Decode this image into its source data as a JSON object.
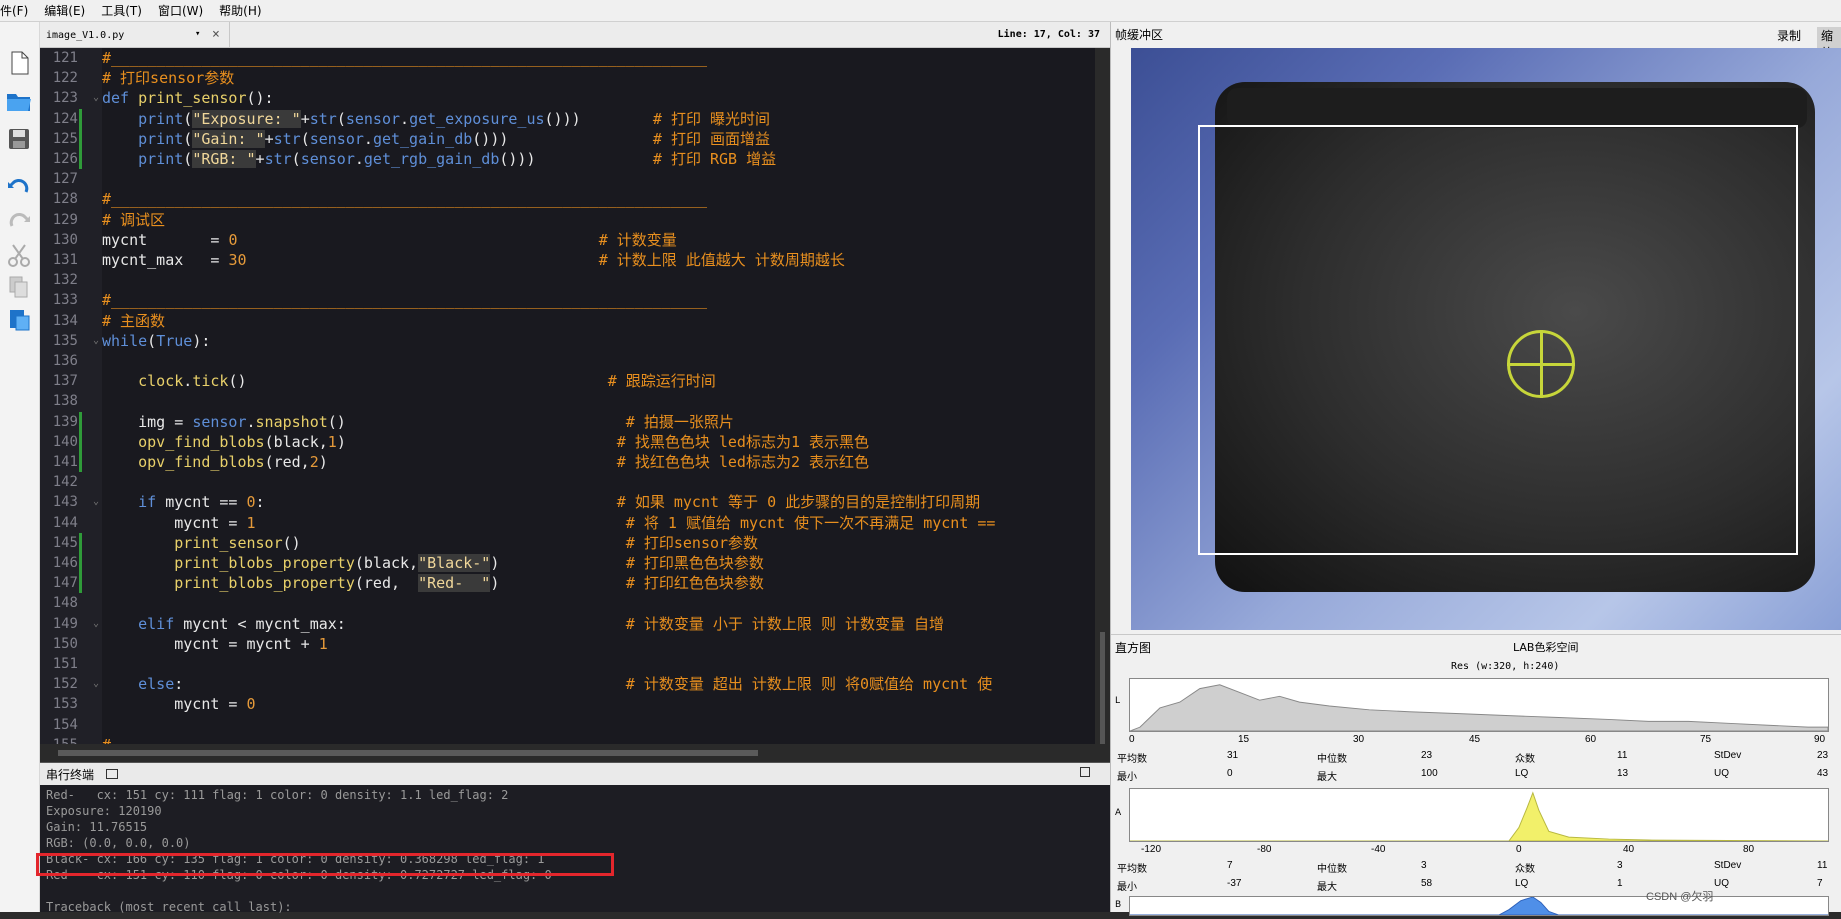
{
  "menu": [
    "件(F)",
    "编辑(E)",
    "工具(T)",
    "窗口(W)",
    "帮助(H)"
  ],
  "editor": {
    "tab_name": "image_V1.0.py",
    "dropdown_glyph": "▾",
    "close_glyph": "×",
    "line_col": "Line: 17, Col: 37",
    "lines": [
      {
        "n": "121",
        "fold": "",
        "bar": false,
        "h": "<span class=\"cm\">#__________________________________________________________________</span>"
      },
      {
        "n": "122",
        "fold": "",
        "bar": false,
        "h": "<span class=\"cm\"># 打印sensor参数</span>"
      },
      {
        "n": "123",
        "fold": "⌄",
        "bar": false,
        "h": "<span class=\"kw\">def</span> <span class=\"fn\">print_sensor</span>():"
      },
      {
        "n": "124",
        "fold": "",
        "bar": true,
        "h": "    <span class=\"bi\">print</span>(<span class=\"sth\">\"Exposure: \"</span>+<span class=\"bi\">str</span>(<span class=\"sn\">sensor</span>.<span class=\"bi\">get_exposure_us</span>()))        <span class=\"cm\"># 打印 曝光时间</span>"
      },
      {
        "n": "125",
        "fold": "",
        "bar": true,
        "h": "    <span class=\"bi\">print</span>(<span class=\"sth\">\"Gain: \"</span>+<span class=\"bi\">str</span>(<span class=\"sn\">sensor</span>.<span class=\"bi\">get_gain_db</span>()))                <span class=\"cm\"># 打印 画面增益</span>"
      },
      {
        "n": "126",
        "fold": "",
        "bar": true,
        "h": "    <span class=\"bi\">print</span>(<span class=\"sth\">\"RGB: \"</span>+<span class=\"bi\">str</span>(<span class=\"sn\">sensor</span>.<span class=\"bi\">get_rgb_gain_db</span>()))             <span class=\"cm\"># 打印 RGB 增益</span>"
      },
      {
        "n": "127",
        "fold": "",
        "bar": false,
        "h": ""
      },
      {
        "n": "128",
        "fold": "",
        "bar": false,
        "h": "<span class=\"cm\">#__________________________________________________________________</span>"
      },
      {
        "n": "129",
        "fold": "",
        "bar": false,
        "h": "<span class=\"cm\"># 调试区</span>"
      },
      {
        "n": "130",
        "fold": "",
        "bar": false,
        "h": "mycnt       = <span class=\"nm\">0</span>                                        <span class=\"cm\"># 计数变量</span>"
      },
      {
        "n": "131",
        "fold": "",
        "bar": false,
        "h": "mycnt_max   = <span class=\"nm\">30</span>                                       <span class=\"cm\"># 计数上限 此值越大 计数周期越长</span>"
      },
      {
        "n": "132",
        "fold": "",
        "bar": false,
        "h": ""
      },
      {
        "n": "133",
        "fold": "",
        "bar": false,
        "h": "<span class=\"cm\">#__________________________________________________________________</span>"
      },
      {
        "n": "134",
        "fold": "",
        "bar": false,
        "h": "<span class=\"cm\"># 主函数</span>"
      },
      {
        "n": "135",
        "fold": "⌄",
        "bar": false,
        "h": "<span class=\"kw\">while</span>(<span class=\"kw\">True</span>):"
      },
      {
        "n": "136",
        "fold": "",
        "bar": false,
        "h": ""
      },
      {
        "n": "137",
        "fold": "",
        "bar": false,
        "h": "    <span class=\"fc\">clock</span>.<span class=\"fc\">tick</span>()                                        <span class=\"cm\"># 跟踪运行时间</span>"
      },
      {
        "n": "138",
        "fold": "",
        "bar": false,
        "h": ""
      },
      {
        "n": "139",
        "fold": "",
        "bar": true,
        "h": "    img = <span class=\"sn\">sensor</span>.<span class=\"fc\">snapshot</span>()                               <span class=\"cm\"># 拍摄一张照片</span>"
      },
      {
        "n": "140",
        "fold": "",
        "bar": true,
        "h": "    <span class=\"fc\">opv_find_blobs</span>(black,<span class=\"nm\">1</span>)                              <span class=\"cm\"># 找黑色色块 led标志为1 表示黑色</span>"
      },
      {
        "n": "141",
        "fold": "",
        "bar": true,
        "h": "    <span class=\"fc\">opv_find_blobs</span>(red,<span class=\"nm\">2</span>)                                <span class=\"cm\"># 找红色色块 led标志为2 表示红色</span>"
      },
      {
        "n": "142",
        "fold": "",
        "bar": false,
        "h": ""
      },
      {
        "n": "143",
        "fold": "⌄",
        "bar": false,
        "h": "    <span class=\"kw\">if</span> mycnt == <span class=\"nm\">0</span>:                                       <span class=\"cm\"># 如果 mycnt 等于 0 此步骤的目的是控制打印周期</span>"
      },
      {
        "n": "144",
        "fold": "",
        "bar": false,
        "h": "        mycnt = <span class=\"nm\">1</span>                                         <span class=\"cm\"># 将 1 赋值给 mycnt 使下一次不再满足 mycnt ==</span>"
      },
      {
        "n": "145",
        "fold": "",
        "bar": true,
        "h": "        <span class=\"fc\">print_sensor</span>()                                    <span class=\"cm\"># 打印sensor参数</span>"
      },
      {
        "n": "146",
        "fold": "",
        "bar": true,
        "h": "        <span class=\"fc\">print_blobs_property</span>(black,<span class=\"sth\">\"Black-\"</span>)              <span class=\"cm\"># 打印黑色色块参数</span>"
      },
      {
        "n": "147",
        "fold": "",
        "bar": true,
        "h": "        <span class=\"fc\">print_blobs_property</span>(red,  <span class=\"sth\">\"Red-  \"</span>)              <span class=\"cm\"># 打印红色色块参数</span>"
      },
      {
        "n": "148",
        "fold": "",
        "bar": false,
        "h": ""
      },
      {
        "n": "149",
        "fold": "⌄",
        "bar": false,
        "h": "    <span class=\"kw\">elif</span> mycnt &lt; mycnt_max:                               <span class=\"cm\"># 计数变量 小于 计数上限 则 计数变量 自增</span>"
      },
      {
        "n": "150",
        "fold": "",
        "bar": false,
        "h": "        mycnt = mycnt + <span class=\"nm\">1</span>"
      },
      {
        "n": "151",
        "fold": "",
        "bar": false,
        "h": ""
      },
      {
        "n": "152",
        "fold": "⌄",
        "bar": false,
        "h": "    <span class=\"kw\">else</span>:                                                 <span class=\"cm\"># 计数变量 超出 计数上限 则 将0赋值给 mycnt 使</span>"
      },
      {
        "n": "153",
        "fold": "",
        "bar": false,
        "h": "        mycnt = <span class=\"nm\">0</span>"
      },
      {
        "n": "154",
        "fold": "",
        "bar": false,
        "h": ""
      },
      {
        "n": "155",
        "fold": "",
        "bar": false,
        "h": "<span class=\"cm\">#__________________________________________________________________</span>"
      }
    ]
  },
  "serial": {
    "title": "串行终端",
    "lines": [
      "Red-   cx: 151 cy: 111 flag: 1 color: 0 density: 1.1 led_flag: 2",
      "Exposure: 120190",
      "Gain: 11.76515",
      "RGB: (0.0, 0.0, 0.0)",
      "Black- cx: 166 cy: 135 flag: 1 color: 0 density: 0.368298 led_flag: 1",
      "Red-   cx: 151 cy: 110 flag: 0 color: 0 density: 0.7272727 led_flag: 0",
      "",
      "Traceback (most recent call last):"
    ]
  },
  "framebuffer": {
    "title": "帧缓冲区",
    "record": "录制",
    "zoom": "缩放"
  },
  "histogram": {
    "title": "直方图",
    "colorspace": "LAB色彩空间",
    "res": "Res (w:320, h:240)",
    "channels": [
      {
        "axis": "L",
        "ticks": [
          "0",
          "15",
          "30",
          "45",
          "60",
          "75",
          "90"
        ],
        "stats1": [
          "平均数",
          "31",
          "中位数",
          "23",
          "众数",
          "11",
          "StDev",
          "23"
        ],
        "stats2": [
          "最小",
          "0",
          "最大",
          "100",
          "LQ",
          "13",
          "UQ",
          "43"
        ]
      },
      {
        "axis": "A",
        "ticks": [
          "-120",
          "-80",
          "-40",
          "0",
          "40",
          "80"
        ],
        "stats1": [
          "平均数",
          "7",
          "中位数",
          "3",
          "众数",
          "3",
          "StDev",
          "11"
        ],
        "stats2": [
          "最小",
          "-37",
          "最大",
          "58",
          "LQ",
          "1",
          "UQ",
          "7"
        ]
      },
      {
        "axis": "B"
      }
    ]
  },
  "watermark": "CSDN @欠羽"
}
